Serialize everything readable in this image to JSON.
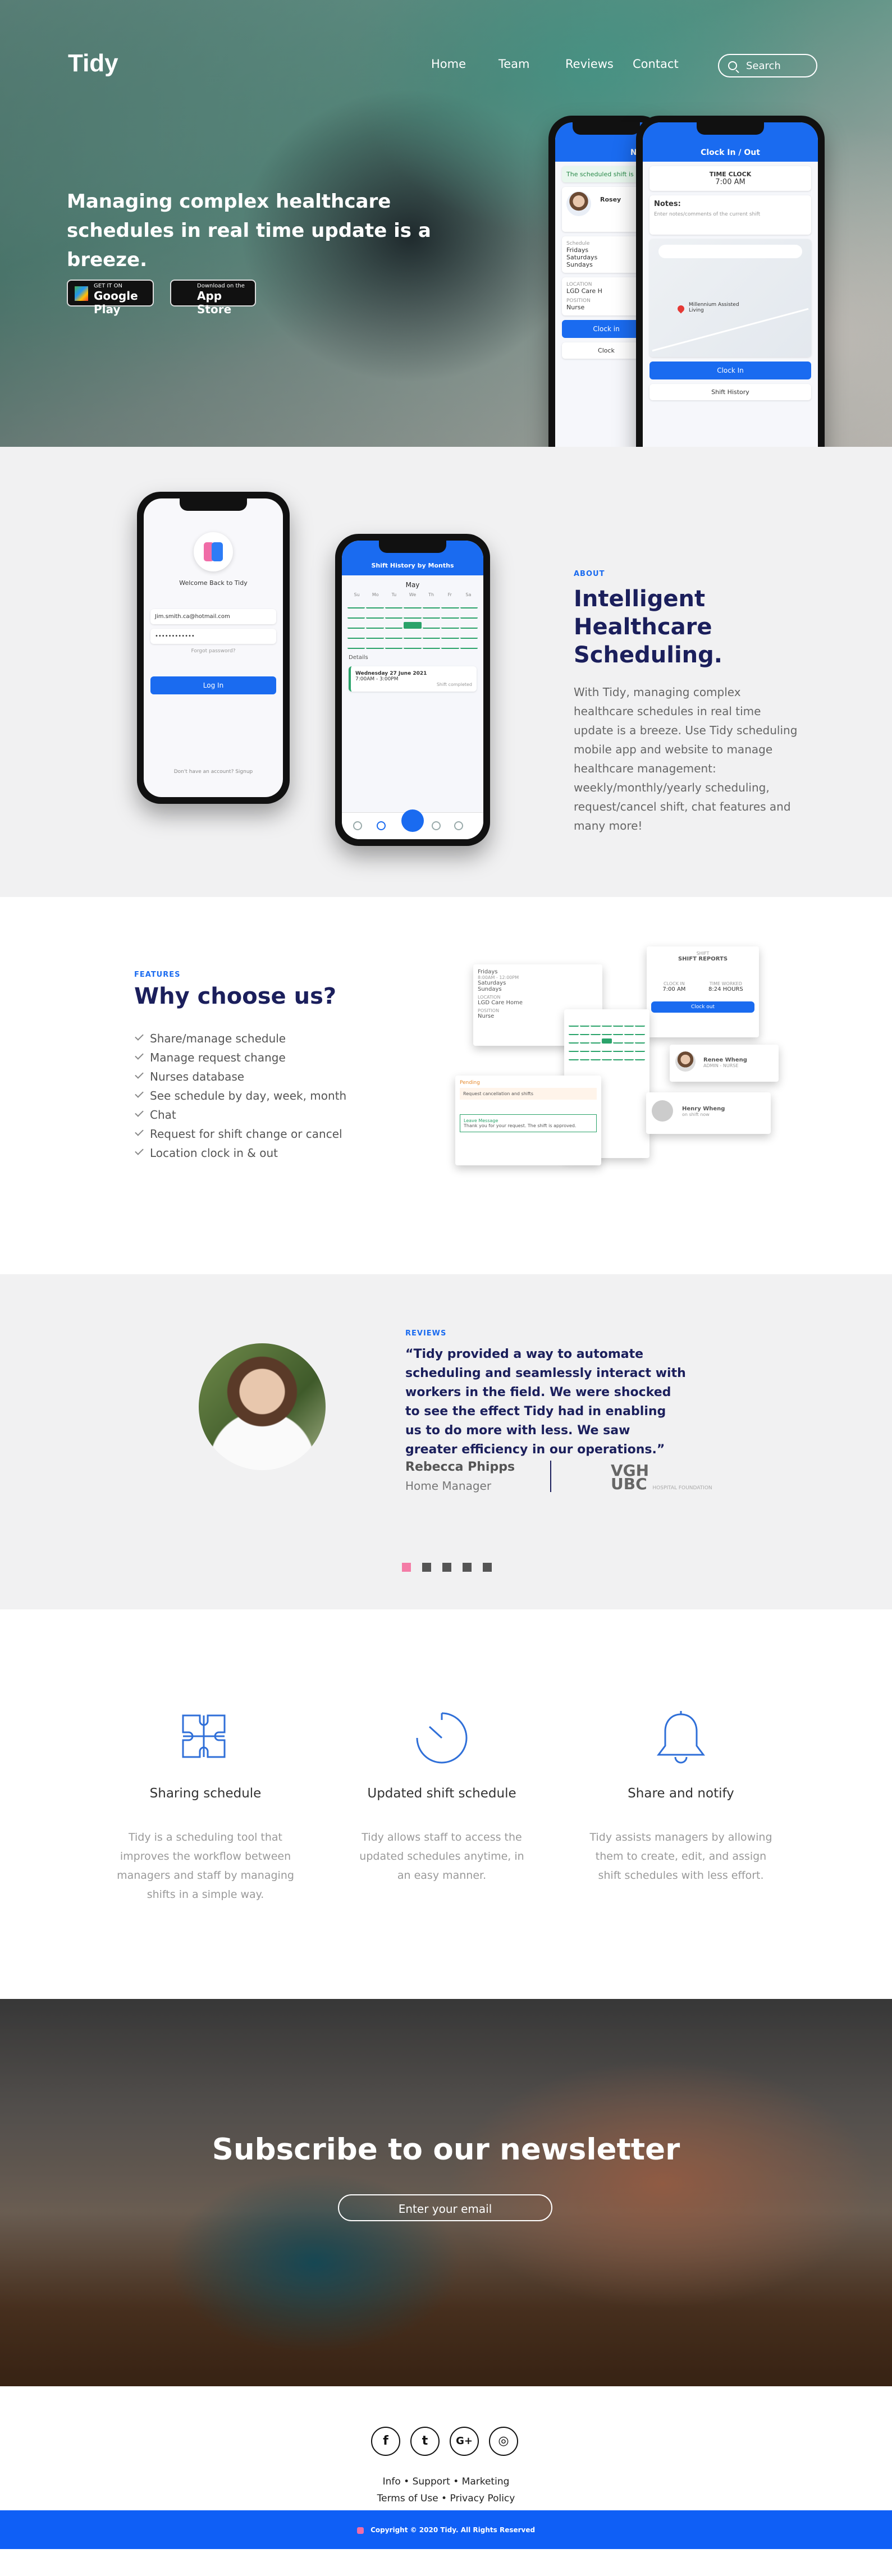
{
  "brand": "Tidy",
  "nav": {
    "items": [
      "Home",
      "Team",
      "Reviews",
      "Contact"
    ],
    "search_placeholder": "Search"
  },
  "hero": {
    "headline": "Managing complex healthcare schedules in real time update is a breeze.",
    "google_play": {
      "small": "GET IT ON",
      "big": "Google Play"
    },
    "app_store": {
      "small": "Download on the",
      "big": "App Store"
    }
  },
  "phones": {
    "clock_title": "Clock In / Out",
    "time_clock_label": "TIME CLOCK",
    "time_clock_value": "7:00 AM",
    "notes_label": "Notes:",
    "notes_placeholder": "Enter notes/comments of the current shift",
    "map_label": "Millennium Assisted Living",
    "clock_in_button": "Clock In",
    "shift_history_button": "Shift History",
    "back_title": "New",
    "shift_notice": "The scheduled shift is",
    "back_name": "Rosey",
    "back_time": "Schedule",
    "back_days": [
      "Fridays",
      "Saturdays",
      "Sundays"
    ],
    "back_location_label": "LOCATION",
    "back_location": "LGD Care H",
    "back_position_label": "POSITION",
    "back_position": "Nurse",
    "back_button": "Clock in",
    "back_button2": "Clock",
    "welcome": "Welcome Back to Tidy",
    "email_placeholder": "Jim.smith.ca@hotmail.com",
    "password_placeholder": "••••••••••••",
    "forgot": "Forgot password?",
    "login_button": "Log In",
    "signup_text": "Don't have an account? Signup",
    "calendar_title": "Shift History by Months",
    "calendar_month": "May",
    "weekdays": [
      "Su",
      "Mo",
      "Tu",
      "We",
      "Th",
      "Fr",
      "Sa"
    ],
    "details_label": "Details",
    "detail_date": "Wednesday 27 June 2021",
    "detail_time": "7:00AM - 3:00PM",
    "detail_status": "Shift completed"
  },
  "about": {
    "kicker": "ABOUT",
    "title": "Intelligent Healthcare Scheduling.",
    "text": "With Tidy, managing complex healthcare schedules in real time update is a breeze. Use Tidy scheduling mobile app and website to manage healthcare management: weekly/monthly/yearly scheduling, request/cancel shift, chat features and many more!"
  },
  "features": {
    "kicker": "FEATURES",
    "title": "Why choose us?",
    "items": [
      "Share/manage schedule",
      "Manage request change",
      "Nurses database",
      "See schedule by day, week, month",
      "Chat",
      "Request for shift change or cancel",
      "Location clock in & out"
    ],
    "cards": {
      "schedule_days": [
        "Fridays",
        "Saturdays",
        "Sundays"
      ],
      "schedule_times": [
        "8:00AM - 12:00PM",
        "8:00AM - 12:00PM",
        "8:00AM - 12:00PM"
      ],
      "location_label": "LOCATION",
      "location_value": "LGD Care Home",
      "position_label": "POSITION",
      "position_value": "Nurse",
      "clock_label": "SHIFT",
      "clock_title": "SHIFT REPORTS",
      "clock_in": "CLOCK IN",
      "clock_in_val": "7:00 AM",
      "total": "TIME WORKED",
      "total_val": "8:24 HOURS",
      "clock_btn": "Clock out",
      "pending_label": "Pending",
      "pending_text": "Request cancellation and shifts",
      "user1": "Renee Wheng",
      "user1_role": "ADMIN - NURSE",
      "user2": "Henry Wheng",
      "user2_role": "on shift now",
      "chat_label": "Leave Message",
      "chat_text": "Thank you for your request. The shift is approved."
    }
  },
  "reviews": {
    "kicker": "REVIEWS",
    "quote": "“Tidy provided a way to automate scheduling and seamlessly interact with workers in the field. We were shocked to see the effect Tidy had in enabling us to do more with less. We saw greater efficiency in our operations.”",
    "name": "Rebecca Phipps",
    "role": "Home Manager",
    "org_logo_top": "VGH",
    "org_logo_bottom": "UBC",
    "org_logo_small": "HOSPITAL FOUNDATION",
    "dot_count": 5,
    "active_dot": 0,
    "accent": "#f47ca6"
  },
  "services": [
    {
      "icon": "puzzle-icon",
      "title": "Sharing schedule",
      "text": "Tidy is a scheduling tool that improves the workflow between managers and staff by managing shifts in a simple way."
    },
    {
      "icon": "clock-icon",
      "title": "Updated shift schedule",
      "text": "Tidy allows staff to access the updated schedules anytime, in an easy manner."
    },
    {
      "icon": "bell-icon",
      "title": "Share and notify",
      "text": "Tidy assists managers by allowing them to create, edit, and assign shift schedules with less effort."
    }
  ],
  "newsletter": {
    "title": "Subscribe to our newsletter",
    "placeholder": "Enter your email"
  },
  "footer": {
    "social": [
      "facebook-icon",
      "twitter-icon",
      "google-plus-icon",
      "instagram-icon"
    ],
    "social_glyphs": [
      "f",
      "t",
      "G+",
      "◎"
    ],
    "links_row1": "Info • Support • Marketing",
    "links_row2": "Terms of Use • Privacy Policy",
    "copyright": "Copyright © 2020 Tidy. All Rights Reserved"
  },
  "colors": {
    "primary": "#1a6bf0",
    "navy": "#1b1f5c",
    "footer_bar": "#0f5ff6"
  }
}
